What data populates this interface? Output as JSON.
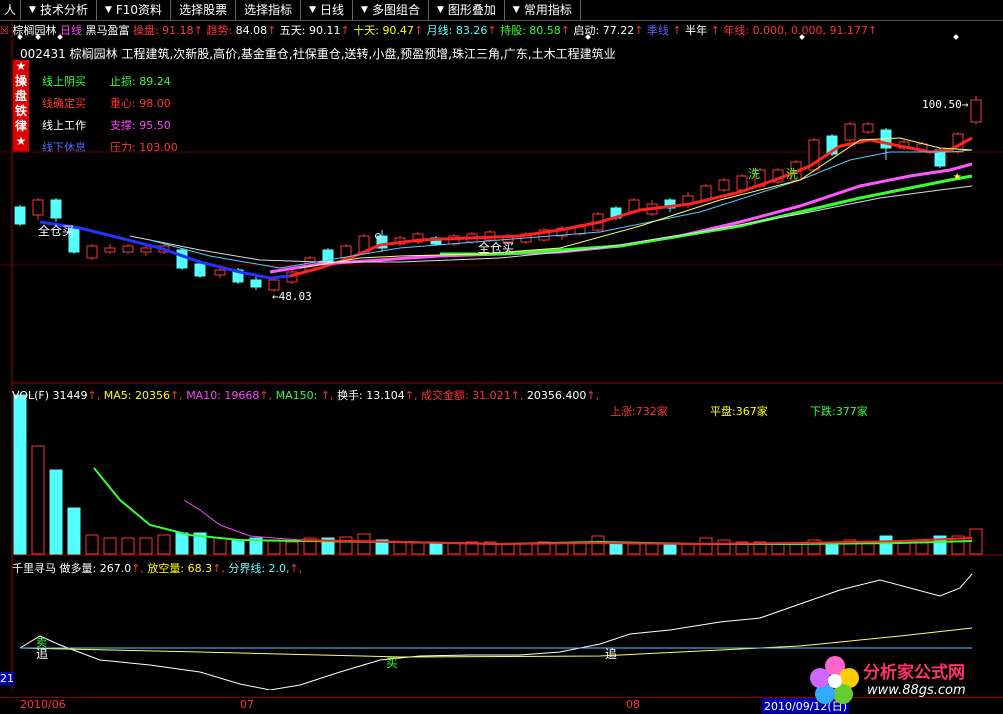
{
  "toolbar": {
    "items": [
      {
        "label": "人",
        "arrow": ""
      },
      {
        "label": "技术分析",
        "arrow": "▼"
      },
      {
        "label": "F10资料",
        "arrow": "▼"
      },
      {
        "label": "选择股票",
        "arrow": ""
      },
      {
        "label": "选择指标",
        "arrow": ""
      },
      {
        "label": "日线",
        "arrow": "▼"
      },
      {
        "label": "多图组合",
        "arrow": "▼"
      },
      {
        "label": "图形叠加",
        "arrow": "▼"
      },
      {
        "label": "常用指标",
        "arrow": "▼"
      }
    ]
  },
  "header": {
    "stock_name": "棕榈园林",
    "period": "日线",
    "indicator": "黑马盈富",
    "fields": [
      {
        "label": "操盘:",
        "value": "91.18",
        "labelColor": "#ff3333",
        "valueColor": "#ff3333"
      },
      {
        "label": "趋势:",
        "value": "84.08",
        "labelColor": "#ff3333",
        "valueColor": "#ffffff"
      },
      {
        "label": "五天:",
        "value": "90.11",
        "labelColor": "#ffffff",
        "valueColor": "#ffffff"
      },
      {
        "label": "十天:",
        "value": "90.47",
        "labelColor": "#ffff00",
        "valueColor": "#ffff00"
      },
      {
        "label": "月线:",
        "value": "83.26",
        "labelColor": "#55ffff",
        "valueColor": "#55ffff"
      },
      {
        "label": "持股:",
        "value": "80.58",
        "labelColor": "#33ff33",
        "valueColor": "#33ff33"
      },
      {
        "label": "启动:",
        "value": "77.22",
        "labelColor": "#ffffff",
        "valueColor": "#ffffff"
      },
      {
        "label": "季线",
        "value": "",
        "labelColor": "#5566ff",
        "valueColor": "#5566ff"
      },
      {
        "label": "半年",
        "value": "",
        "labelColor": "#ffffff",
        "valueColor": "#ffffff"
      },
      {
        "label": "年线:",
        "value": "0.000, 0.000, 91.177",
        "labelColor": "#ff3333",
        "valueColor": "#ff3333"
      }
    ]
  },
  "info_line": "002431 棕榈园林 工程建筑,次新股,高价,基金重仓,社保重仓,送转,小盘,预盈预增,珠江三角,广东,土木工程建筑业",
  "sidebar_chars": [
    "★",
    "操",
    "盘",
    "铁",
    "律",
    "★"
  ],
  "rules": [
    {
      "text": "线上阴买",
      "color": "#33ff33"
    },
    {
      "text": "线确定买",
      "color": "#ff3333"
    },
    {
      "text": "线上工作",
      "color": "#ffffff"
    },
    {
      "text": "线下休息",
      "color": "#5566ff"
    }
  ],
  "levels": [
    {
      "label": "止损:",
      "value": "89.24",
      "color": "#33ff33"
    },
    {
      "label": "重心:",
      "value": "98.00",
      "color": "#ff3333"
    },
    {
      "label": "支撑:",
      "value": "95.50",
      "color": "#ff44ff"
    },
    {
      "label": "压力:",
      "value": "103.00",
      "color": "#ff3333"
    }
  ],
  "annotations": {
    "high_price": "100.50",
    "low_price": "48.03",
    "full_buy_1": "全仓买",
    "full_buy_2": "全仓买",
    "wash_1": "洗",
    "wash_2": "洗"
  },
  "vol_header": {
    "fields": [
      {
        "label": "VOL(F)",
        "value": "31449",
        "color": "#ffffff"
      },
      {
        "label": "MA5:",
        "value": "20356",
        "color": "#ffff00"
      },
      {
        "label": "MA10:",
        "value": "19668",
        "color": "#ff44ff"
      },
      {
        "label": "MA150:",
        "value": "",
        "color": "#33ff33"
      },
      {
        "label": "换手:",
        "value": "13.104",
        "color": "#ffffff"
      },
      {
        "label": "成交金额:",
        "value": "31.021",
        "color": "#ff3333"
      },
      {
        "label": "",
        "value": "20356.400",
        "color": "#ffffff"
      }
    ]
  },
  "market_breadth": {
    "up": "上涨:732家",
    "flat": "平盘:367家",
    "down": "下跌:377家"
  },
  "osc_header": {
    "name": "千里寻马",
    "fields": [
      {
        "label": "做多量:",
        "value": "267.0",
        "color": "#ffffff"
      },
      {
        "label": "放空量:",
        "value": "68.3",
        "color": "#ffff00"
      },
      {
        "label": "分界线:",
        "value": "2.0,",
        "color": "#55ffff"
      }
    ]
  },
  "osc_labels": {
    "chase_1": "追",
    "chase_2": "追",
    "buy": "买",
    "sell": "卖"
  },
  "date_axis": {
    "d1": "2010/06",
    "d2": "07",
    "d3": "08",
    "d4": "2010/09/12(日)"
  },
  "left_axis_label": "21",
  "logo": {
    "name": "分析家公式网",
    "url": "www.88gs.com"
  },
  "colors": {
    "up_candle": "#ff3333",
    "down_candle": "#55ffff",
    "ma_red": "#ff2222",
    "ma_magenta": "#ff55ff",
    "ma_green": "#33ff33",
    "ma_blue": "#2233ff"
  }
}
